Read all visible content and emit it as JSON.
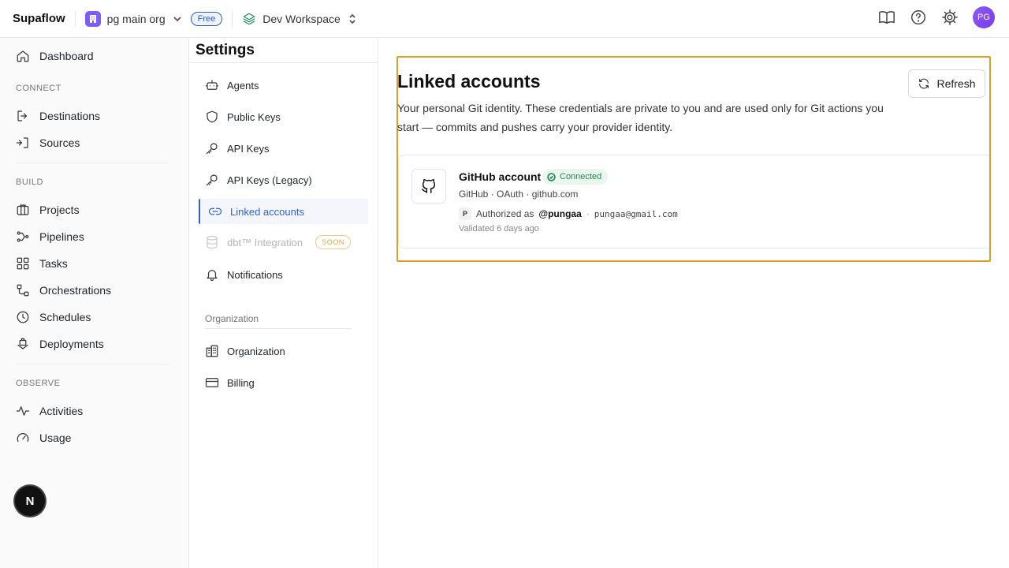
{
  "topbar": {
    "brand": "Supaflow",
    "org_name": "pg main org",
    "plan_badge": "Free",
    "workspace": "Dev Workspace",
    "avatar_initials": "PG",
    "icons": [
      "docs-book-icon",
      "help-icon",
      "settings-gear-icon"
    ]
  },
  "sidebar": {
    "dashboard": "Dashboard",
    "sections": {
      "connect": "CONNECT",
      "build": "BUILD",
      "observe": "OBSERVE"
    },
    "connect_items": [
      "Destinations",
      "Sources"
    ],
    "build_items": [
      "Projects",
      "Pipelines",
      "Tasks",
      "Orchestrations",
      "Schedules",
      "Deployments"
    ],
    "observe_items": [
      "Activities",
      "Usage"
    ],
    "floating_button": "N"
  },
  "settings": {
    "title": "Settings",
    "items": [
      "Agents",
      "Public Keys",
      "API Keys",
      "API Keys (Legacy)",
      "Linked accounts",
      "dbt™ Integration",
      "Notifications"
    ],
    "active_item": "Linked accounts",
    "soon_badge": "SOON",
    "organization_label": "Organization",
    "organization_items": [
      "Organization",
      "Billing"
    ]
  },
  "main": {
    "title": "Linked accounts",
    "description": "Your personal Git identity. These credentials are private to you and are used only for Git actions you start — commits and pushes carry your provider identity.",
    "refresh_label": "Refresh",
    "account": {
      "name": "GitHub account",
      "status": "Connected",
      "meta": "GitHub · OAuth · github.com",
      "provider_initial": "P",
      "authorized_prefix": "Authorized as",
      "handle": "@pungaa",
      "separator": "·",
      "email": "pungaa@gmail.com",
      "validated": "Validated 6 days ago"
    }
  },
  "colors": {
    "accent": "#2d5fd8",
    "highlight_border": "#d8a02a",
    "connected": "#1e8a4c",
    "org_badge": "#7c5cff",
    "avatar": "#7c3aed"
  }
}
